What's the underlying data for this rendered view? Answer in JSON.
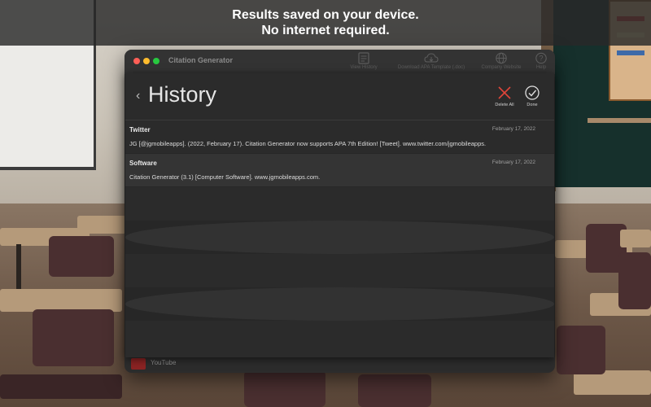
{
  "banner": {
    "line1": "Results saved on your device.",
    "line2": "No internet required."
  },
  "window": {
    "title": "Citation Generator",
    "toolbar": {
      "view_history": "View History",
      "download_template": "Download APA Template (.doc)",
      "company_website": "Company Website",
      "help": "Help"
    },
    "background_item": "YouTube"
  },
  "history": {
    "title": "History",
    "back_icon": "chevron-left-icon",
    "delete_all_label": "Delete All",
    "done_label": "Done",
    "accent_delete": "#e0453a",
    "entries": [
      {
        "type": "Twitter",
        "date": "February 17, 2022",
        "citation": "JG [@jgmobileapps]. (2022, February 17). Citation Generator now supports APA 7th Edition! [Tweet]. www.twitter.com/jgmobileapps."
      },
      {
        "type": "Software",
        "date": "February 17, 2022",
        "citation": "Citation Generator (3.1) [Computer Software]. www.jgmobileapps.com."
      }
    ]
  }
}
